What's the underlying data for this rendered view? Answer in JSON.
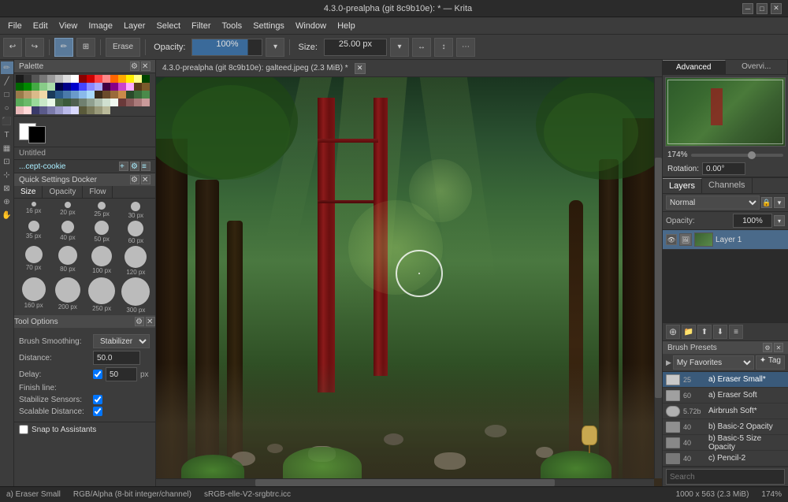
{
  "titlebar": {
    "text": "4.3.0-prealpha (git 8c9b10e): * — Krita",
    "minimize": "─",
    "maximize": "□",
    "close": "✕"
  },
  "menubar": {
    "items": [
      "File",
      "Edit",
      "View",
      "Image",
      "Layer",
      "Select",
      "Filter",
      "Tools",
      "Settings",
      "Window",
      "Help"
    ]
  },
  "toolbar": {
    "opacity_label": "Opacity:",
    "opacity_value": "100%",
    "size_label": "Size:",
    "size_value": "25.00 px",
    "erase_label": "Erase"
  },
  "canvas_tab": {
    "title": "4.3.0-prealpha (git 8c9b10e): galteed.jpeg (2.3 MiB) *"
  },
  "palette": {
    "title": "Palette",
    "brush_name": "...cept-cookie",
    "untitled_label": "Untitled"
  },
  "quick_settings": {
    "title": "Quick Settings Docker",
    "tabs": [
      "Size",
      "Opacity",
      "Flow"
    ],
    "brush_sizes": [
      {
        "label": "16 px",
        "size": 6
      },
      {
        "label": "20 px",
        "size": 8
      },
      {
        "label": "25 px",
        "size": 10
      },
      {
        "label": "30 px",
        "size": 12
      },
      {
        "label": "35 px",
        "size": 14
      },
      {
        "label": "40 px",
        "size": 16
      },
      {
        "label": "50 px",
        "size": 20
      },
      {
        "label": "60 px",
        "size": 22
      },
      {
        "label": "70 px",
        "size": 24
      },
      {
        "label": "80 px",
        "size": 26
      },
      {
        "label": "100 px",
        "size": 28
      },
      {
        "label": "120 px",
        "size": 30
      },
      {
        "label": "160 px",
        "size": 32
      },
      {
        "label": "200 px",
        "size": 34
      },
      {
        "label": "250 px",
        "size": 36
      },
      {
        "label": "300 px",
        "size": 38
      }
    ]
  },
  "tool_options": {
    "title": "Tool Options",
    "brush_smoothing_label": "Brush Smoothing:",
    "brush_smoothing_value": "Stabilizer",
    "distance_label": "Distance:",
    "distance_value": "50.0",
    "delay_label": "Delay:",
    "delay_value": "50",
    "delay_unit": "px",
    "finish_line_label": "Finish line:",
    "stabilize_sensors_label": "Stabilize Sensors:",
    "scalable_distance_label": "Scalable Distance:"
  },
  "snap_row": {
    "label": "Snap to Assistants"
  },
  "right_panel": {
    "adv_tab": "Advanced",
    "overview_tab": "Overvi...",
    "zoom_value": "174%",
    "rotation_label": "Rotation:",
    "rotation_value": "0.00°"
  },
  "layers": {
    "title": "Layers",
    "tabs": [
      "Layers",
      "Channels"
    ],
    "mode": "Normal",
    "opacity": "100%",
    "items": [
      {
        "name": "Layer 1",
        "visible": true,
        "active": true
      }
    ],
    "toolbar_buttons": [
      "⊕",
      "⊟",
      "⬆",
      "⬇",
      "≡"
    ]
  },
  "brush_presets": {
    "title": "Brush Presets",
    "favorites_label": "My Favorites",
    "tag_label": "Tag",
    "items": [
      {
        "size": "25",
        "name": "a) Eraser Small*",
        "active": true,
        "color": "#c8c8c8"
      },
      {
        "size": "60",
        "name": "a) Eraser Soft",
        "active": false,
        "color": "#a0a0a0"
      },
      {
        "size": "5.72b",
        "name": "Airbrush Soft*",
        "active": false,
        "color": "#b0b0b0"
      },
      {
        "size": "40",
        "name": "b) Basic-2 Opacity",
        "active": false,
        "color": "#909090"
      },
      {
        "size": "40",
        "name": "b) Basic-5 Size Opacity",
        "active": false,
        "color": "#888888"
      },
      {
        "size": "40",
        "name": "c) Pencil-2",
        "active": false,
        "color": "#787878"
      }
    ],
    "search_placeholder": "Search"
  },
  "status_bar": {
    "color_mode": "RGB/Alpha (8-bit integer/channel)",
    "profile": "sRGB-elle-V2-srgbtrc.icc",
    "dimensions": "1000 x 563 (2.3 MiB)",
    "zoom": "174%",
    "brush_name": "a) Eraser Small"
  },
  "colors": {
    "active_bg": "#4a6a8a",
    "tab_active": "#2b2b2b",
    "accent": "#5a7a9a",
    "brush_active_bg": "#3a5a7a"
  }
}
